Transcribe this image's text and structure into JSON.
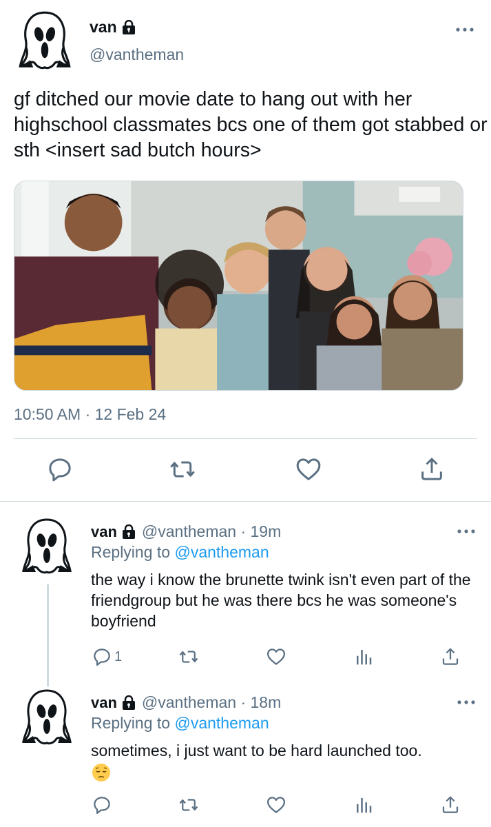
{
  "main_tweet": {
    "display_name": "van",
    "handle": "@vantheman",
    "text": "gf ditched our movie date to hang out with her highschool classmates bcs one of them got stabbed or sth <insert sad butch hours>",
    "timestamp": "10:50 AM · 12 Feb 24",
    "actions": [
      "reply-icon",
      "retweet-icon",
      "like-icon",
      "share-icon"
    ]
  },
  "replies": [
    {
      "display_name": "van",
      "handle_time": "@vantheman · 19m",
      "replying_prefix": "Replying to",
      "replying_to": "@vantheman",
      "text": "the way i know the brunette twink isn't even part of the friendgroup but he was there bcs he was someone's boyfriend",
      "reply_count": "1",
      "actions": [
        "reply-icon",
        "retweet-icon",
        "like-icon",
        "analytics-icon",
        "share-icon"
      ]
    },
    {
      "display_name": "van",
      "handle_time": "@vantheman · 18m",
      "replying_prefix": "Replying to",
      "replying_to": "@vantheman",
      "text": "sometimes, i just want to be hard launched too.",
      "emoji": "pensive-face-emoji",
      "actions": [
        "reply-icon",
        "retweet-icon",
        "like-icon",
        "analytics-icon",
        "share-icon"
      ]
    }
  ],
  "colors": {
    "text": "#0f1419",
    "secondary": "#5b7083",
    "link": "#1d9bf0",
    "divider": "#cfd9de"
  }
}
